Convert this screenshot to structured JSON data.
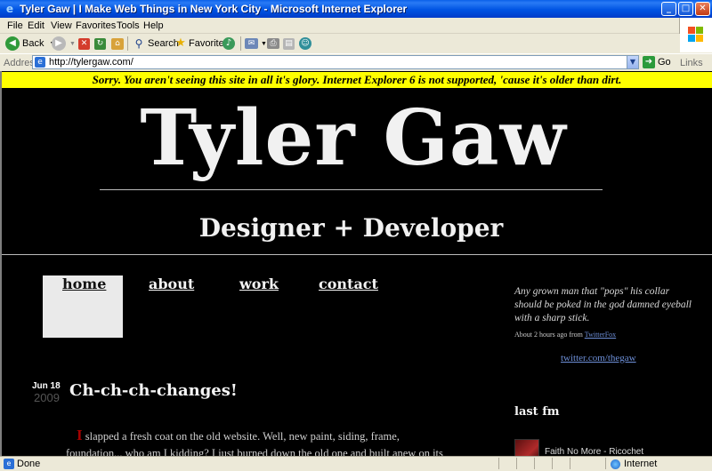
{
  "window": {
    "title": "Tyler Gaw  |  I Make Web Things in New York City - Microsoft Internet Explorer",
    "controls": {
      "minimize": "_",
      "maximize": "□",
      "close": "✕"
    }
  },
  "menubar": {
    "items": [
      "File",
      "Edit",
      "View",
      "Favorites",
      "Tools",
      "Help"
    ]
  },
  "toolbar": {
    "back_label": "Back",
    "search_label": "Search",
    "favorites_label": "Favorites"
  },
  "addressbar": {
    "label": "Address",
    "url": "http://tylergaw.com/",
    "go_label": "Go",
    "links_label": "Links"
  },
  "page": {
    "ie_warning": "Sorry. You aren't seeing this site in all it's glory. Internet Explorer 6 is not supported, 'cause it's older than dirt.",
    "site_title": "Tyler Gaw",
    "tagline": "Designer + Developer",
    "nav": [
      {
        "label": "home",
        "active": true
      },
      {
        "label": "about",
        "active": false
      },
      {
        "label": "work",
        "active": false
      },
      {
        "label": "contact",
        "active": false
      }
    ],
    "tweet": {
      "text": "Any grown man that \"pops\" his collar should be poked in the god damned eyeball with a sharp stick.",
      "meta_prefix": "About 2 hours ago from ",
      "meta_source": "TwitterFox"
    },
    "twitter_link": "twitter.com/thegaw",
    "post": {
      "date": "Jun 18",
      "year": "2009",
      "title": "Ch-ch-ch-changes!",
      "dropcap": "I",
      "body_line1": " slapped a fresh coat on the old website. Well, new paint, siding, frame,",
      "body_line2": "foundation... who am I kidding? I just burned down the old one and built anew on its"
    },
    "lastfm": {
      "heading": "last fm",
      "track": "Faith No More - Ricochet"
    }
  },
  "statusbar": {
    "status": "Done",
    "zone": "Internet"
  },
  "colors": {
    "titlebar": "#0054e3",
    "warning_bg": "#ffff00",
    "page_bg": "#000000",
    "link": "#6d8fd8",
    "dropcap": "#a40000"
  }
}
